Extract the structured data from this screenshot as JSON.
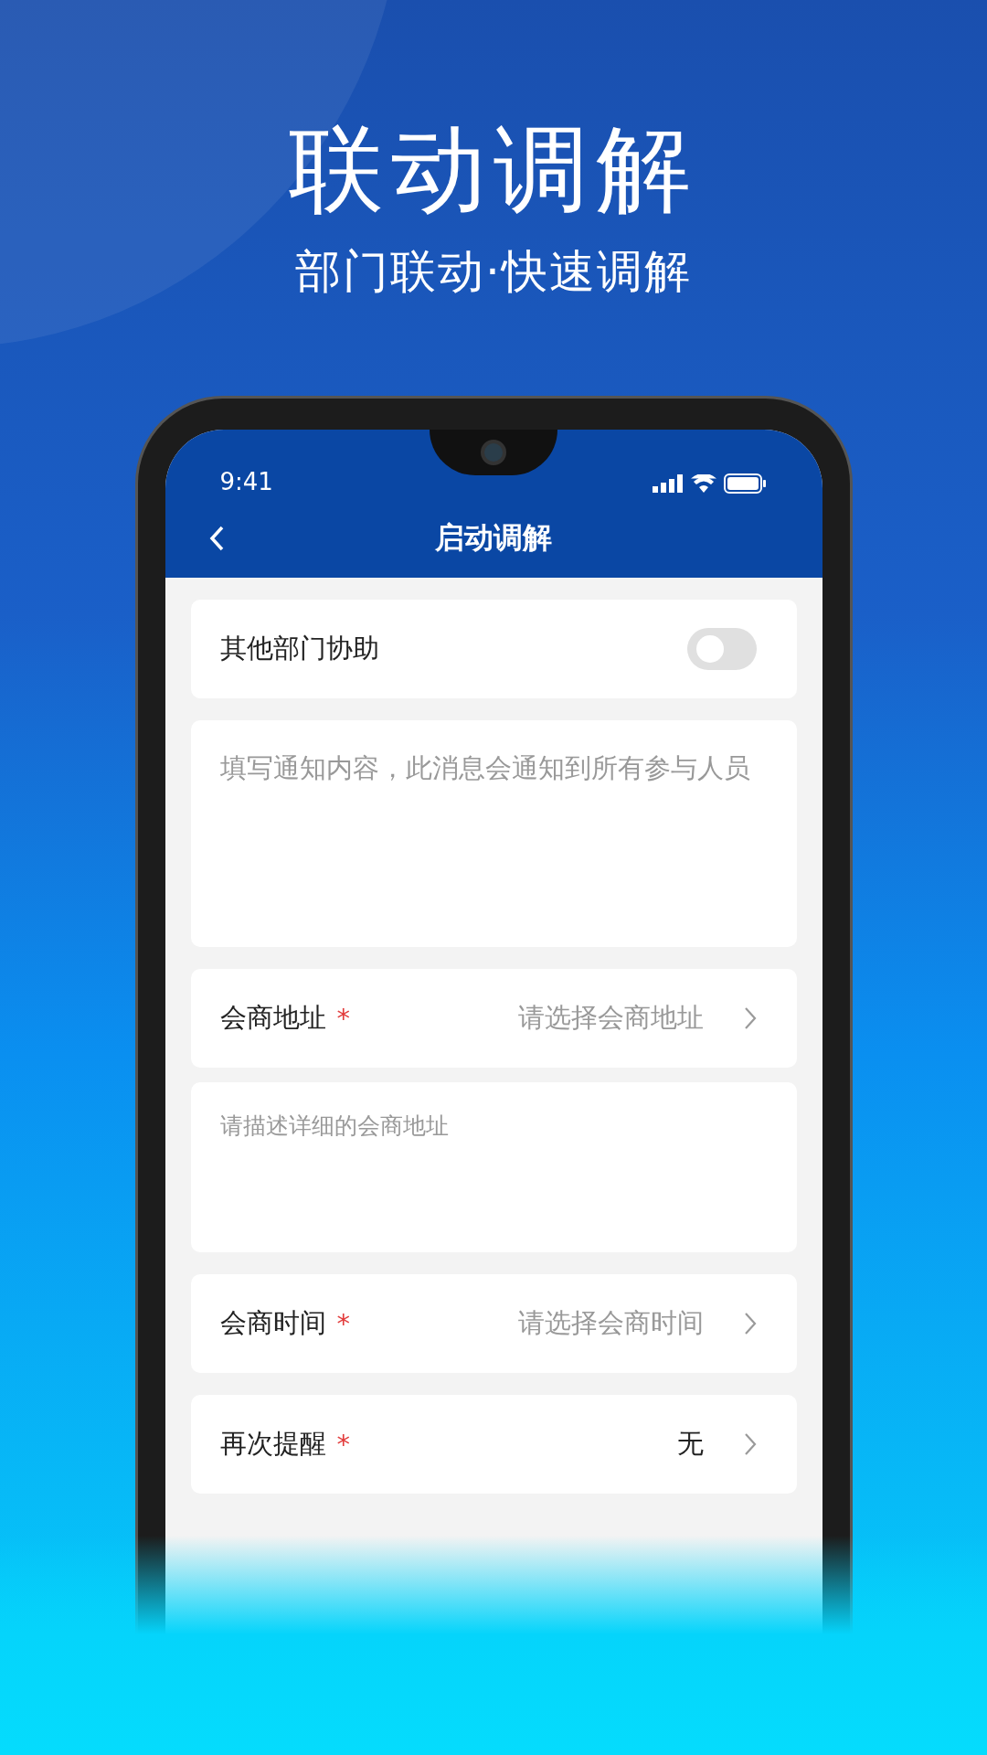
{
  "headline": "联动调解",
  "subtitle": "部门联动·快速调解",
  "status_bar": {
    "time": "9:41"
  },
  "nav": {
    "title": "启动调解"
  },
  "fields": [
    {
      "kind": "toggle",
      "label": "其他部门协助",
      "on": false
    },
    {
      "kind": "notice",
      "placeholder": "填写通知内容，此消息会通知到所有参与人员"
    },
    {
      "kind": "select",
      "label": "会商地址",
      "mark": "*",
      "placeholder": "请选择会商地址"
    },
    {
      "kind": "textarea",
      "placeholder": "请描述详细的会商地址"
    },
    {
      "kind": "select",
      "label": "会商时间",
      "mark": "*",
      "placeholder": "请选择会商时间"
    },
    {
      "kind": "select",
      "label": "再次提醒",
      "mark": "*",
      "value": "无"
    }
  ]
}
